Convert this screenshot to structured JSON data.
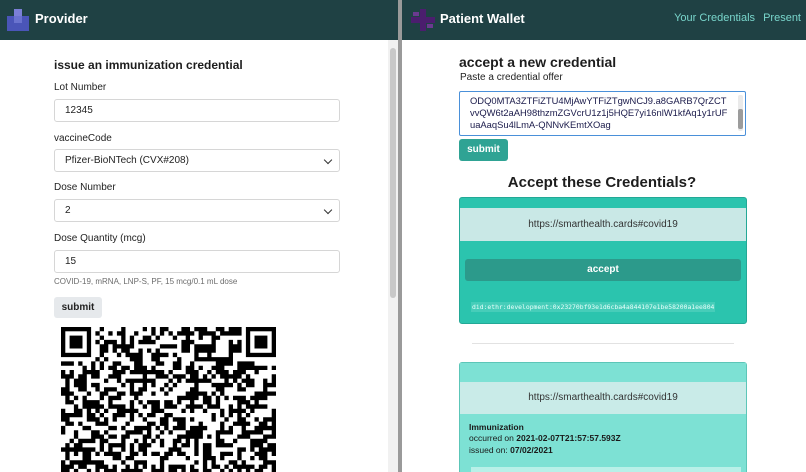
{
  "provider": {
    "brand": "Provider",
    "form_title": "issue an immunization credential",
    "lot_number_label": "Lot Number",
    "lot_number_value": "12345",
    "vaccine_code_label": "vaccineCode",
    "vaccine_code_value": "Pfizer-BioNTech (CVX#208)",
    "dose_number_label": "Dose Number",
    "dose_number_value": "2",
    "dose_quantity_label": "Dose Quantity (mcg)",
    "dose_quantity_value": "15",
    "help_text": "COVID-19, mRNA, LNP-S, PF, 15 mcg/0.1 mL dose",
    "submit_label": "submit"
  },
  "wallet": {
    "brand": "Patient Wallet",
    "nav": [
      "Your Credentials",
      "Present"
    ],
    "title": "accept a new credential",
    "subtitle": "Paste a credential offer",
    "offer_text": "ODQ0MTA3ZTFiZTU4MjAwYTFiZTgwNCJ9.a8GARB7QrZCTvvQW6t2aAH98thzmZGVcrU1z1j5HQE7yi16nlW1kfAq1y1rUFuaAaqSu4lLmA-QNNvKEmtXOag",
    "submit_label": "submit",
    "accept_heading": "Accept these Credentials?",
    "card1": {
      "type_url": "https://smarthealth.cards#covid19",
      "accept_label": "accept",
      "did": "did:ethr:development:0x23270bf93e1d6cba4a844107e1be58200a1ee804"
    },
    "card2": {
      "type_url": "https://smarthealth.cards#covid19",
      "kind": "Immunization",
      "occurred_label": "occurred on",
      "occurred_value": "2021-02-07T21:57:57.593Z",
      "issued_label": "issued on:",
      "issued_value": "07/02/2021"
    }
  },
  "colors": {
    "topbar": "#1f4144",
    "accent": "#2fa394",
    "nav_link": "#79d6cc",
    "card1": "#2bc4ae",
    "card2": "#7de1d4"
  }
}
